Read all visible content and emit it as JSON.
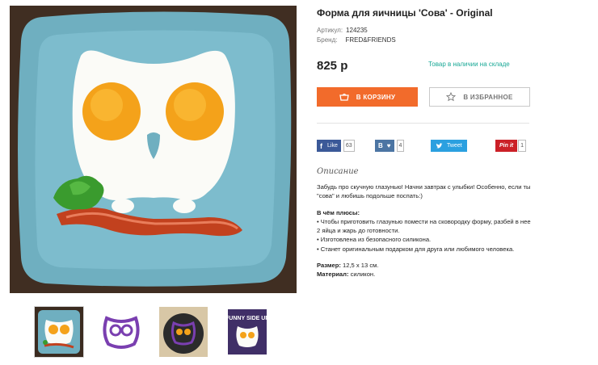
{
  "product": {
    "title": "Форма для яичницы 'Сова' - Original",
    "sku_label": "Артикул:",
    "sku_value": "124235",
    "brand_label": "Бренд:",
    "brand_value": "FRED&FRIENDS",
    "price": "825 р",
    "stock": "Товар в наличии на складе"
  },
  "buttons": {
    "cart": "В КОРЗИНУ",
    "favorites": "В ИЗБРАННОЕ"
  },
  "social": {
    "facebook_label": "Like",
    "facebook_count": "63",
    "vk_label": "В",
    "vk_count": "4",
    "twitter_label": "Tweet",
    "pinterest_label": "Pin it",
    "pinterest_count": "1"
  },
  "description": {
    "heading": "Описание",
    "intro": "Забудь про скучную глазунью! Начни завтрак с улыбки! Особенно, если ты \"сова\" и любишь подольше поспать:)",
    "plus_heading": "В чём плюсы:",
    "bullets": [
      "• Чтобы приготовить глазунью помести на сковородку форму, разбей в нее 2 яйца и жарь до готовности.",
      "• Изготовлена из безопасного силикона.",
      "• Станет оригинальным подарком для друга или любимого человека."
    ],
    "size_label": "Размер:",
    "size_value": "12,5 х 13 см.",
    "material_label": "Материал:",
    "material_value": "силикон."
  },
  "thumbnails": {
    "box_text": "FUNNY SIDE UP"
  },
  "colors": {
    "accent": "#f26b2b",
    "stock": "#19a896",
    "facebook": "#3b5998",
    "vk": "#4c75a3",
    "twitter": "#2ba0e0",
    "pinterest": "#cb2027"
  }
}
